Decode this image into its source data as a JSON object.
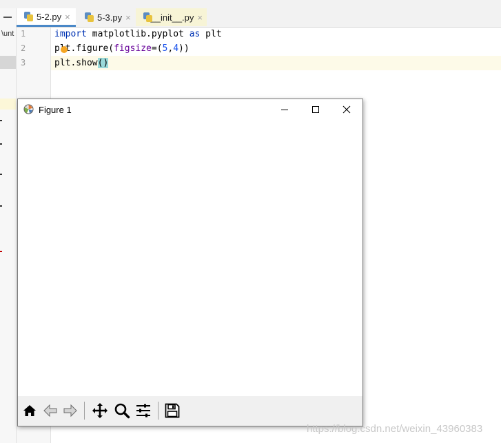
{
  "tabs": [
    {
      "label": "5-2.py",
      "close": "×",
      "active": true
    },
    {
      "label": "5-3.py",
      "close": "×",
      "active": false
    },
    {
      "label": "__init__.py",
      "close": "×",
      "active": false
    }
  ],
  "project_panel": {
    "label": "\\unt"
  },
  "editor": {
    "line_numbers": [
      "1",
      "2",
      "3"
    ],
    "lines": [
      {
        "kw": "import",
        "rest": " matplotlib.pyplot ",
        "kw2": "as",
        "tail": " plt"
      },
      {
        "p1": "plt.figure(",
        "kwarg": "figsize",
        "eq": "=(",
        "n1": "5",
        "comma": ",",
        "n2": "4",
        "end": "))"
      },
      {
        "p1": "plt.show",
        "paren": "()"
      }
    ]
  },
  "figure_window": {
    "title": "Figure 1",
    "controls": [
      "minimize-icon",
      "maximize-icon",
      "close-icon"
    ],
    "toolbar": [
      "home-icon",
      "back-arrow-icon",
      "forward-arrow-icon",
      "pan-icon",
      "zoom-icon",
      "configure-subplots-icon",
      "save-icon"
    ]
  },
  "watermark": "https://blog.csdn.net/weixin_43960383",
  "colors": {
    "keyword": "#0033b3",
    "kwarg": "#660099",
    "number": "#1750eb",
    "tab_underline": "#4a88c7",
    "paren_highlight": "#99d9d9"
  }
}
